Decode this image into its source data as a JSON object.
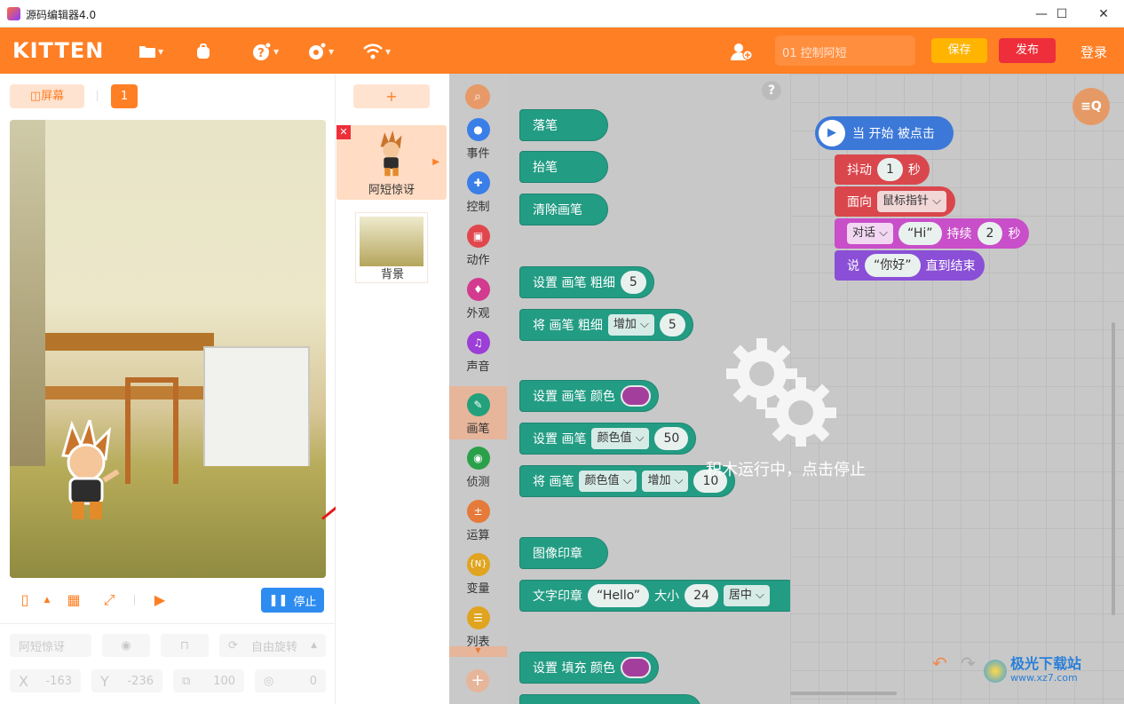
{
  "window": {
    "title": "源码编辑器4.0",
    "minimize": "—",
    "maximize": "☐",
    "close": "✕"
  },
  "header": {
    "logo": "KITTEN",
    "project_name": "01 控制阿短",
    "save_label": "保存",
    "publish_label": "发布",
    "login_label": "登录",
    "icons": [
      "folder-icon",
      "backpack-icon",
      "help-icon",
      "settings-icon",
      "wifi-icon",
      "add-user-icon"
    ]
  },
  "stage": {
    "screen_label": "屏幕",
    "page_number": "1",
    "stop_label": "停止"
  },
  "sprite_props": {
    "name_placeholder": "阿短惊讶",
    "rotation_label": "自由旋转",
    "x_label": "X",
    "x_value": "-163",
    "y_label": "Y",
    "y_value": "-236",
    "size_value": "100",
    "direction_value": "0"
  },
  "sprites": {
    "add_label": "+",
    "items": [
      {
        "name": "阿短惊讶"
      }
    ],
    "background_label": "背景"
  },
  "categories": [
    {
      "name": "事件",
      "color": "#3a7ee8"
    },
    {
      "name": "控制",
      "color": "#3a7ee8"
    },
    {
      "name": "动作",
      "color": "#e0474c"
    },
    {
      "name": "外观",
      "color": "#d23b8e"
    },
    {
      "name": "声音",
      "color": "#9b3fd6"
    },
    {
      "name": "画笔",
      "color": "#23a07c"
    },
    {
      "name": "侦测",
      "color": "#2aa04a"
    },
    {
      "name": "运算",
      "color": "#e57a3a"
    },
    {
      "name": "变量",
      "color": "#e0a420"
    },
    {
      "name": "列表",
      "color": "#e0a420"
    }
  ],
  "blocks": {
    "pen_down": "落笔",
    "pen_up": "抬笔",
    "clear_pen": "清除画笔",
    "set_size_label": "设置 画笔 粗细",
    "set_size_value": "5",
    "change_size_label": "将 画笔 粗细",
    "change_size_op": "增加",
    "change_size_value": "5",
    "set_color_label": "设置 画笔 颜色",
    "set_color_value_label": "设置 画笔",
    "set_color_value_dd": "颜色值",
    "set_color_value_num": "50",
    "change_color_label": "将 画笔",
    "change_color_dd": "颜色值",
    "change_color_op": "增加",
    "change_color_num": "10",
    "stamp": "图像印章",
    "text_stamp_label": "文字印章",
    "text_stamp_text": "“Hello”",
    "text_stamp_size_label": "大小",
    "text_stamp_size": "24",
    "text_stamp_align": "居中",
    "fill_color_label": "设置 填充 颜色"
  },
  "script": {
    "hat": "当 开始 被点击",
    "shake_label": "抖动",
    "shake_value": "1",
    "shake_unit": "秒",
    "face_label": "面向",
    "face_target": "鼠标指针",
    "dialog_dd": "对话",
    "dialog_text": "“Hi”",
    "dialog_duration_label": "持续",
    "dialog_duration": "2",
    "dialog_unit": "秒",
    "say_label": "说",
    "say_text": "“你好”",
    "say_until": "直到结束"
  },
  "overlay": {
    "running_text": "积木运行中，点击停止"
  },
  "watermark": {
    "text": "极光下载站",
    "url": "www.xz7.com"
  }
}
